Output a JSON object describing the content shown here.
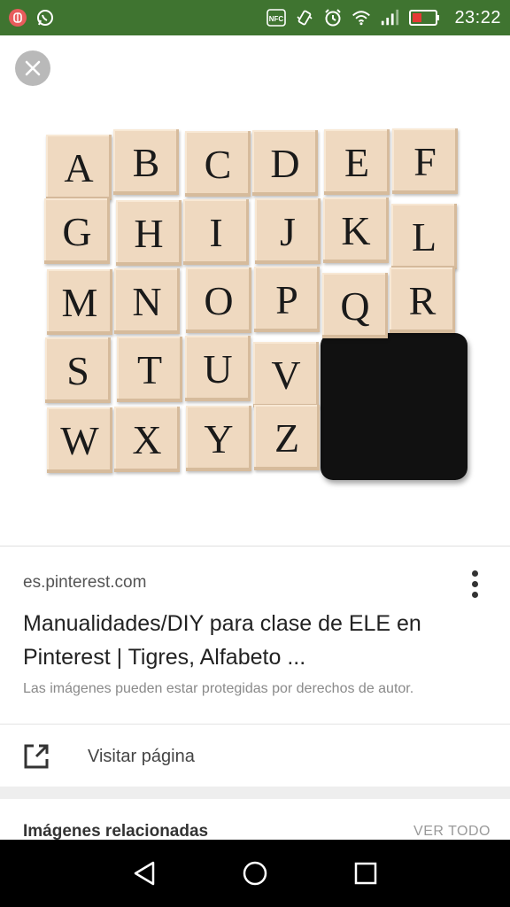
{
  "status_bar": {
    "time": "23:22",
    "icons": [
      "app-notification-icon",
      "whatsapp-icon",
      "nfc-icon",
      "vibrate-icon",
      "alarm-icon",
      "wifi-icon",
      "signal-icon",
      "battery-icon"
    ],
    "nfc_label": "NFC",
    "background": "#3f7430"
  },
  "viewer": {
    "letters": [
      "A",
      "B",
      "C",
      "D",
      "E",
      "F",
      "G",
      "H",
      "I",
      "J",
      "K",
      "L",
      "M",
      "N",
      "O",
      "P",
      "Q",
      "R",
      "S",
      "T",
      "U",
      "V",
      "W",
      "X",
      "Y",
      "Z"
    ]
  },
  "result": {
    "domain": "es.pinterest.com",
    "title": "Manualidades/DIY para clase de ELE en Pinterest | Tigres, Alfabeto ...",
    "copyright": "Las imágenes pueden estar protegidas por derechos de autor.",
    "visit_label": "Visitar página"
  },
  "related": {
    "title": "Imágenes relacionadas",
    "see_all": "VER TODO"
  }
}
